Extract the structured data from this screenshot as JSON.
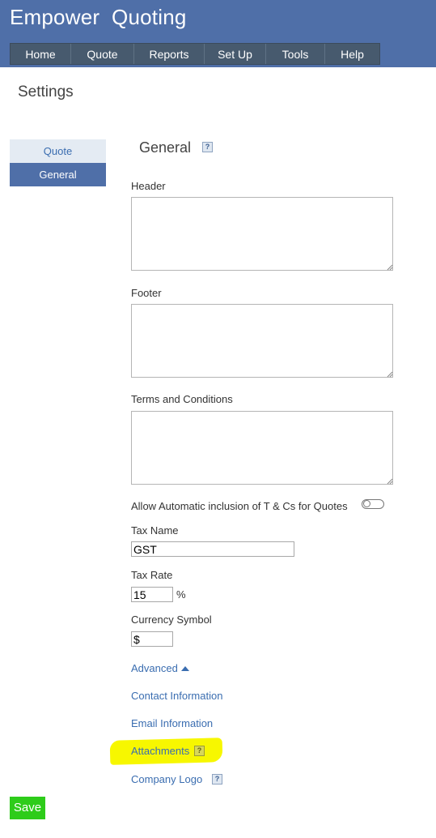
{
  "header": {
    "app_title": "Empower  Quoting",
    "nav": [
      "Home",
      "Quote",
      "Reports",
      "Set Up",
      "Tools",
      "Help"
    ]
  },
  "page": {
    "title": "Settings"
  },
  "sidebar": {
    "items": [
      {
        "label": "Quote",
        "active": false
      },
      {
        "label": "General",
        "active": true
      }
    ]
  },
  "general": {
    "title": "General",
    "help_icon": "help-icon",
    "header_label": "Header",
    "header_value": "",
    "footer_label": "Footer",
    "footer_value": "",
    "terms_label": "Terms and Conditions",
    "terms_value": "",
    "auto_terms_label": "Allow Automatic inclusion of T & Cs for Quotes",
    "auto_terms_enabled": false,
    "tax_name_label": "Tax Name",
    "tax_name_value": "GST",
    "tax_rate_label": "Tax Rate",
    "tax_rate_value": "15",
    "tax_rate_unit": "%",
    "currency_label": "Currency Symbol",
    "currency_value": "$",
    "advanced_label": "Advanced",
    "links": {
      "contact": "Contact Information",
      "email": "Email Information",
      "attachments": "Attachments",
      "company_logo": "Company Logo"
    }
  },
  "colors": {
    "header_bg": "#4f6fa8",
    "nav_bg": "#475a6e",
    "link": "#3a6db0",
    "save_bg": "#2ecc1a",
    "highlight": "#f7f700"
  },
  "footer": {
    "save_label": "Save"
  }
}
